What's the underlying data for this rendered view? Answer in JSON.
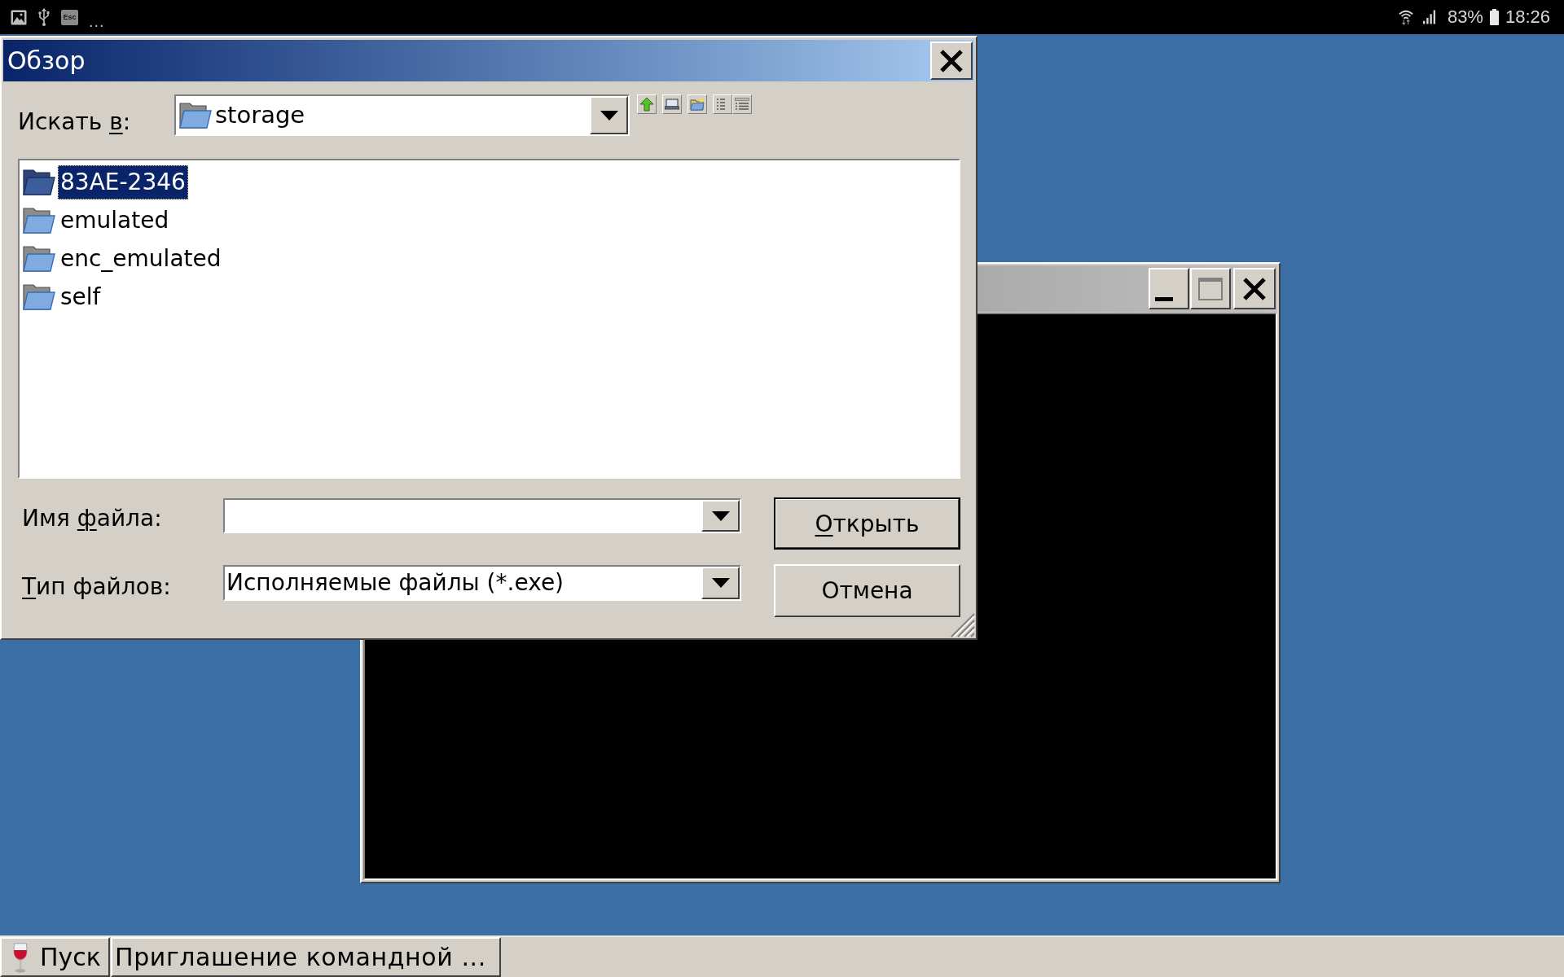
{
  "status_bar": {
    "esc_key": "Esc",
    "more": "...",
    "battery": "83%",
    "time": "18:26"
  },
  "dialog": {
    "title": "Обзор",
    "active": true,
    "look_in": {
      "label": [
        {
          "text": "Искать ",
          "underlined": false
        },
        {
          "text": "в",
          "underlined": true
        },
        {
          "text": ":",
          "underlined": false
        }
      ],
      "value": "storage"
    },
    "files": [
      {
        "name": "83AE-2346",
        "selected": true
      },
      {
        "name": "emulated",
        "selected": false
      },
      {
        "name": "enc_emulated",
        "selected": false
      },
      {
        "name": "self",
        "selected": false
      }
    ],
    "file_name": {
      "label": [
        {
          "text": "Имя ",
          "underlined": false
        },
        {
          "text": "ф",
          "underlined": true
        },
        {
          "text": "айла:",
          "underlined": false
        }
      ]
    },
    "file_type": {
      "label": [
        {
          "text": "Т",
          "underlined": true
        },
        {
          "text": "ип файлов:",
          "underlined": false
        }
      ],
      "value": "Исполняемые файлы (*.exe)"
    },
    "buttons": [
      {
        "label": [
          {
            "text": "О",
            "underlined": true
          },
          {
            "text": "ткрыть",
            "underlined": false
          }
        ],
        "default": true
      },
      {
        "label": [
          {
            "text": "Отмена",
            "underlined": false
          }
        ],
        "default": false
      }
    ]
  },
  "background_window": {
    "active": false
  },
  "taskbar": {
    "start": "Пуск",
    "tasks": [
      "Приглашение командной ..."
    ]
  }
}
